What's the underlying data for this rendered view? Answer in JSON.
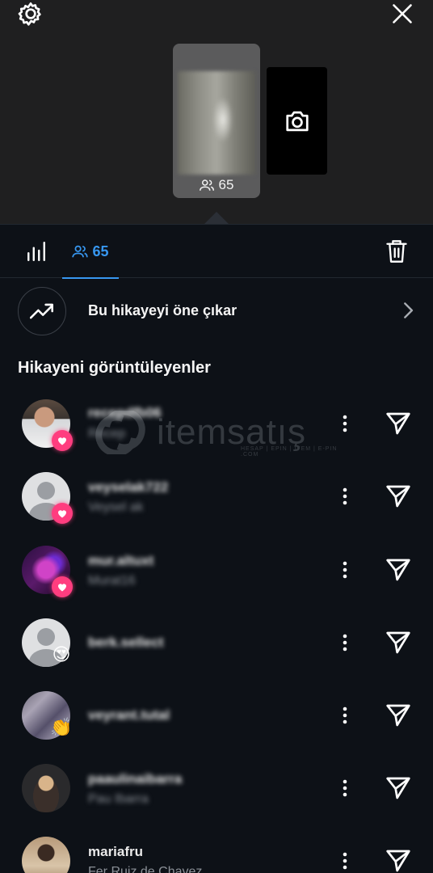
{
  "header": {
    "settings_icon": "gear-icon",
    "close_icon": "close-icon",
    "story_viewer_count": "65",
    "add_story_icon": "camera-icon"
  },
  "tabs": {
    "stats_icon": "bar-chart-icon",
    "viewers_label": "65",
    "delete_icon": "trash-icon",
    "accent": "#3797f0"
  },
  "promote": {
    "label": "Bu hikayeyi öne çıkar",
    "icon": "trending-up-icon"
  },
  "section_title": "Hikayeni görüntüleyenler",
  "watermark": {
    "text": "itemsatış",
    "sub": "HESAP | EPIN | ITEM | E-PIN .COM"
  },
  "viewers": [
    {
      "username": "recepdfb06",
      "full_name": "Recep",
      "reaction": "heart"
    },
    {
      "username": "veyselak722",
      "full_name": "Veysel ak",
      "reaction": "heart"
    },
    {
      "username": "mur.altuxt",
      "full_name": "Murat16",
      "reaction": "heart"
    },
    {
      "username": "berk.sellect",
      "full_name": "",
      "reaction": "😍"
    },
    {
      "username": "veyrant.tutal",
      "full_name": "",
      "reaction": "👏"
    },
    {
      "username": "paaulinaibarra",
      "full_name": "Pau Ibarra",
      "reaction": ""
    },
    {
      "username": "mariafru",
      "full_name": "Fer Ruiz de Chavez",
      "reaction": ""
    }
  ]
}
